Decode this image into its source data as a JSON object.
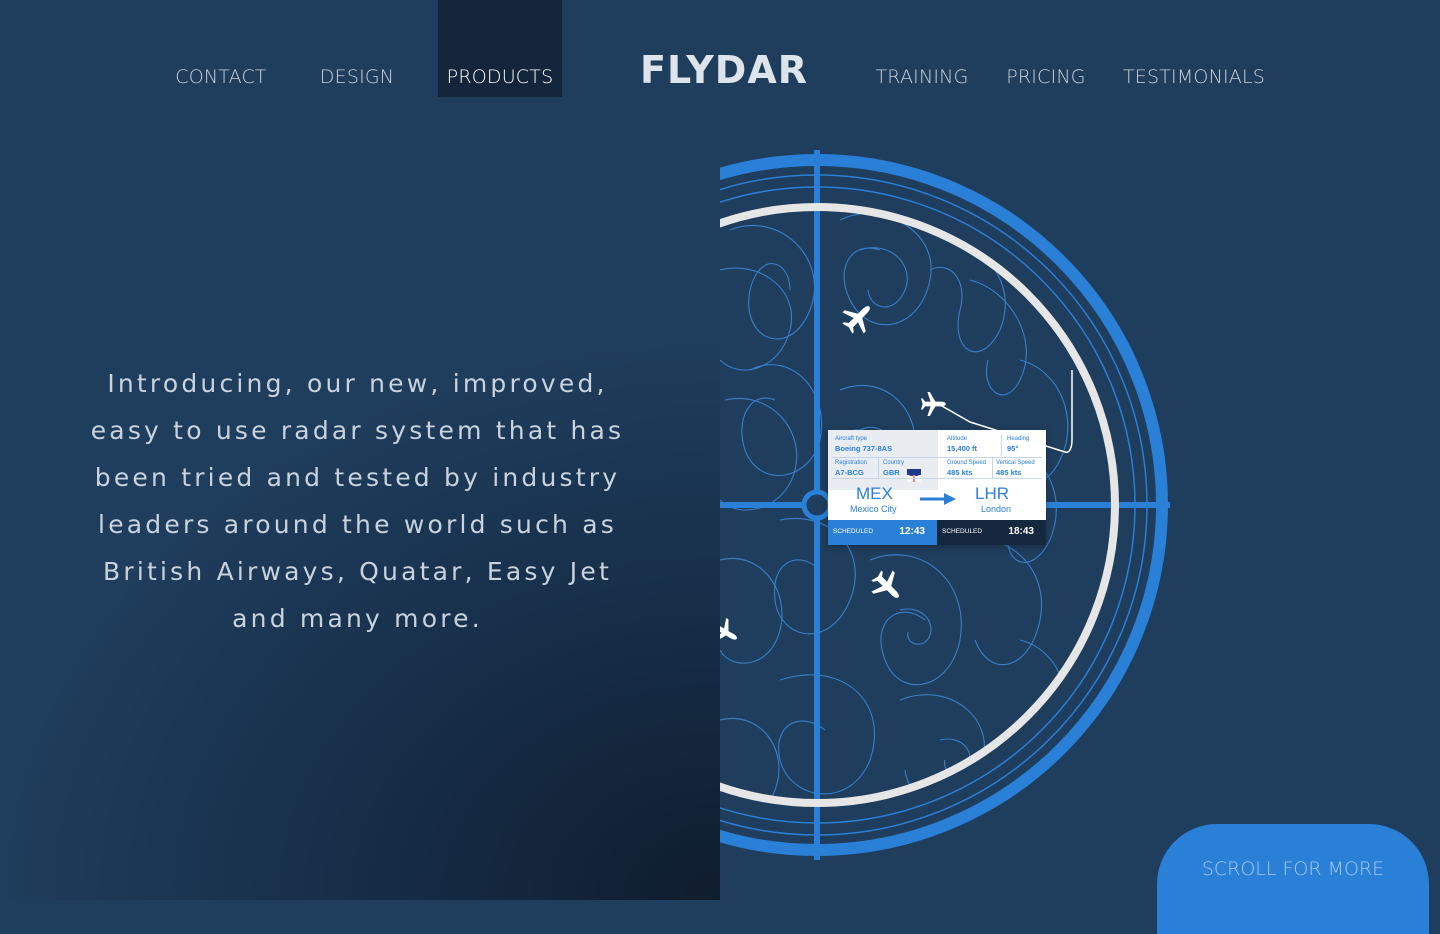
{
  "nav": {
    "left": [
      {
        "label": "CONTACT",
        "active": false
      },
      {
        "label": "DESIGN",
        "active": false
      },
      {
        "label": "PRODUCTS",
        "active": true
      }
    ],
    "logo": "FLYDAR",
    "right": [
      {
        "label": "TRAINING",
        "active": false
      },
      {
        "label": "PRICING",
        "active": false
      },
      {
        "label": "TESTIMONIALS",
        "active": false
      }
    ]
  },
  "hero": {
    "lines": [
      "Introducing, our new, improved,",
      "easy to use radar system that has",
      "been tried and tested by industry",
      "leaders around the world such as",
      "British Airways, Quatar, Easy Jet",
      "and many more."
    ]
  },
  "flight_card": {
    "aircraft_type_label": "Aircraft type",
    "aircraft_type": "Boeing 737-8AS",
    "altitude_label": "Altitude",
    "altitude": "15,400 ft",
    "heading_label": "Heading",
    "heading": "95°",
    "registration_label": "Registration",
    "registration": "A7-BCG",
    "country_label": "Country",
    "country": "GBR",
    "ground_speed_label": "Ground Speed",
    "ground_speed": "485 kts",
    "vertical_speed_label": "Vertical Speed",
    "vertical_speed": "485 kts",
    "origin_code": "MEX",
    "origin_city": "Mexico City",
    "destination_code": "LHR",
    "destination_city": "London",
    "departure_status": "SCHEDULED",
    "departure_time": "12:43",
    "arrival_status": "SCHEDULED",
    "arrival_time": "18:43"
  },
  "scroll_button": "SCROLL FOR MORE",
  "colors": {
    "background": "#1f3d5c",
    "accent": "#2a7fd6",
    "nav_active": "#13253a",
    "text": "#c9d3de"
  }
}
